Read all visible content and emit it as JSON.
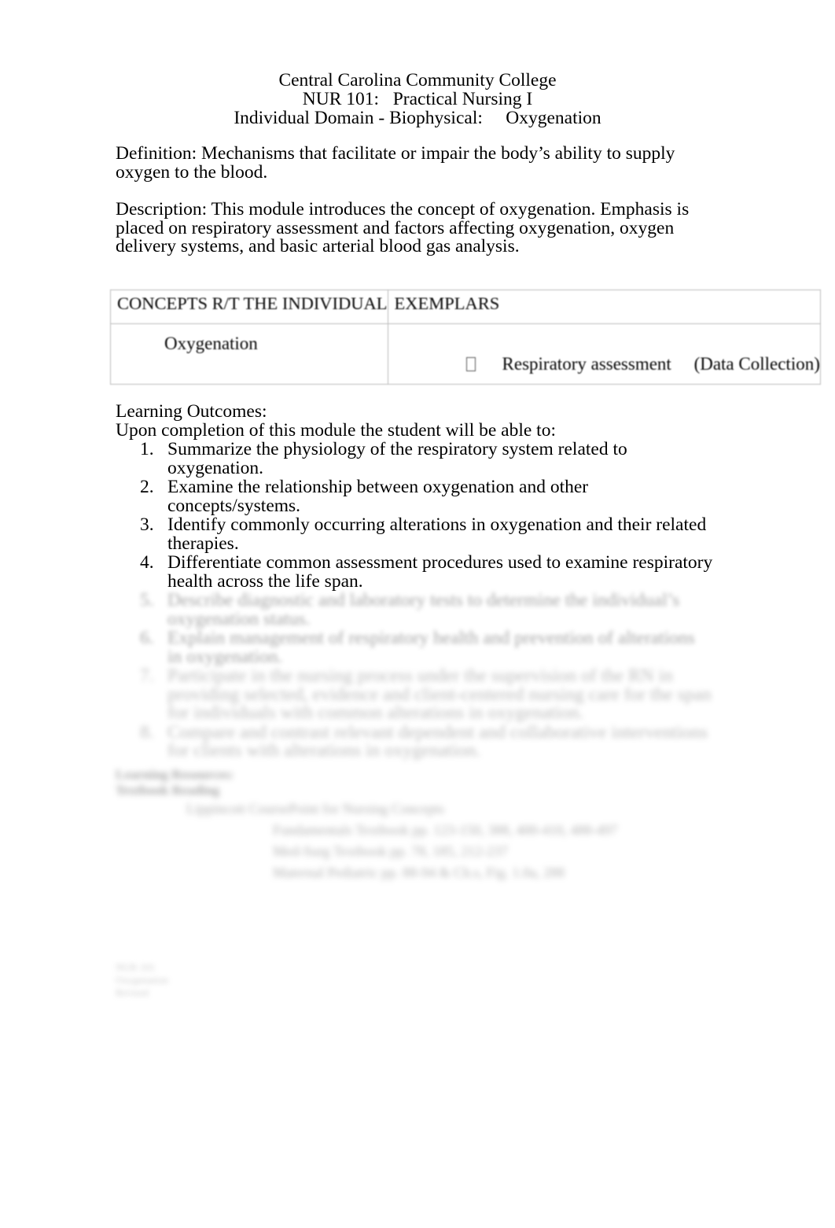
{
  "document": {
    "header": {
      "institution": "Central Carolina Community College",
      "course": "NUR 101:   Practical Nursing I",
      "module": "Individual Domain - Biophysical:     Oxygenation"
    },
    "definition": {
      "label": "Definition:",
      "text": "Definition:  Mechanisms that facilitate or impair the body’s ability to supply oxygen to the blood."
    },
    "description": {
      "label": "Description:",
      "text": "Description:   This module introduces the concept of oxygenation. Emphasis is placed on respiratory assessment and factors affecting oxygenation, oxygen delivery systems, and basic arterial blood gas analysis."
    },
    "table": {
      "headers": {
        "concepts": "CONCEPTS R/T THE INDIVIDUAL",
        "exemplars": "EXEMPLARS"
      },
      "rows": [
        {
          "concept": "Oxygenation",
          "exemplar_bullet": "tofu-box-bullet",
          "exemplar": "Respiratory assessment     (Data Collection)"
        }
      ]
    },
    "learning_outcomes": {
      "title": "Learning Outcomes:",
      "lead": "Upon completion of this module the student will be able to:",
      "items": [
        {
          "number": "1.",
          "text": "Summarize the physiology of the respiratory system related to oxygenation.",
          "legible": true
        },
        {
          "number": "2.",
          "text": "Examine the relationship between oxygenation and other concepts/systems.",
          "legible": true
        },
        {
          "number": "3.",
          "text": "Identify commonly occurring alterations in oxygenation and their related therapies.",
          "legible": true
        },
        {
          "number": "4.",
          "text": "Differentiate common assessment procedures used to examine respiratory health across the life span.",
          "legible": true
        },
        {
          "number": "5.",
          "text": "Describe diagnostic and laboratory tests to determine the individual’s oxygenation status.",
          "legible": false
        },
        {
          "number": "6.",
          "text": "Explain management of respiratory health and prevention of alterations in oxygenation.",
          "legible": false
        },
        {
          "number": "7.",
          "text": "Participate in the nursing process under the supervision of the RN in providing selected, evidence and client-centered nursing care for the span for individuals with common alterations in oxygenation.",
          "legible": false
        },
        {
          "number": "8.",
          "text": "Compare and contrast relevant dependent and collaborative interventions for clients with alterations in oxygenation.",
          "legible": false
        }
      ]
    },
    "resources": {
      "title_line_1": "Learning Resources:",
      "title_line_2": "Textbook Reading",
      "entries": [
        {
          "level": 1,
          "text": "Lippincott CoursePoint for Nursing Concepts"
        },
        {
          "level": 2,
          "text": "Fundamentals Textbook pp. 123-150, 388, 400-410, 488-497"
        },
        {
          "level": 2,
          "text": "Med-Surg Textbook pp. 78, 185, 212-237"
        },
        {
          "level": 2,
          "text": "Maternal Pediatric pp. 88-94 & Ch.s, Fig. 1.0a, 288"
        }
      ]
    },
    "footer_fragment": {
      "lines": [
        "NUR 101",
        "Oxygenation",
        "Revised"
      ]
    }
  }
}
